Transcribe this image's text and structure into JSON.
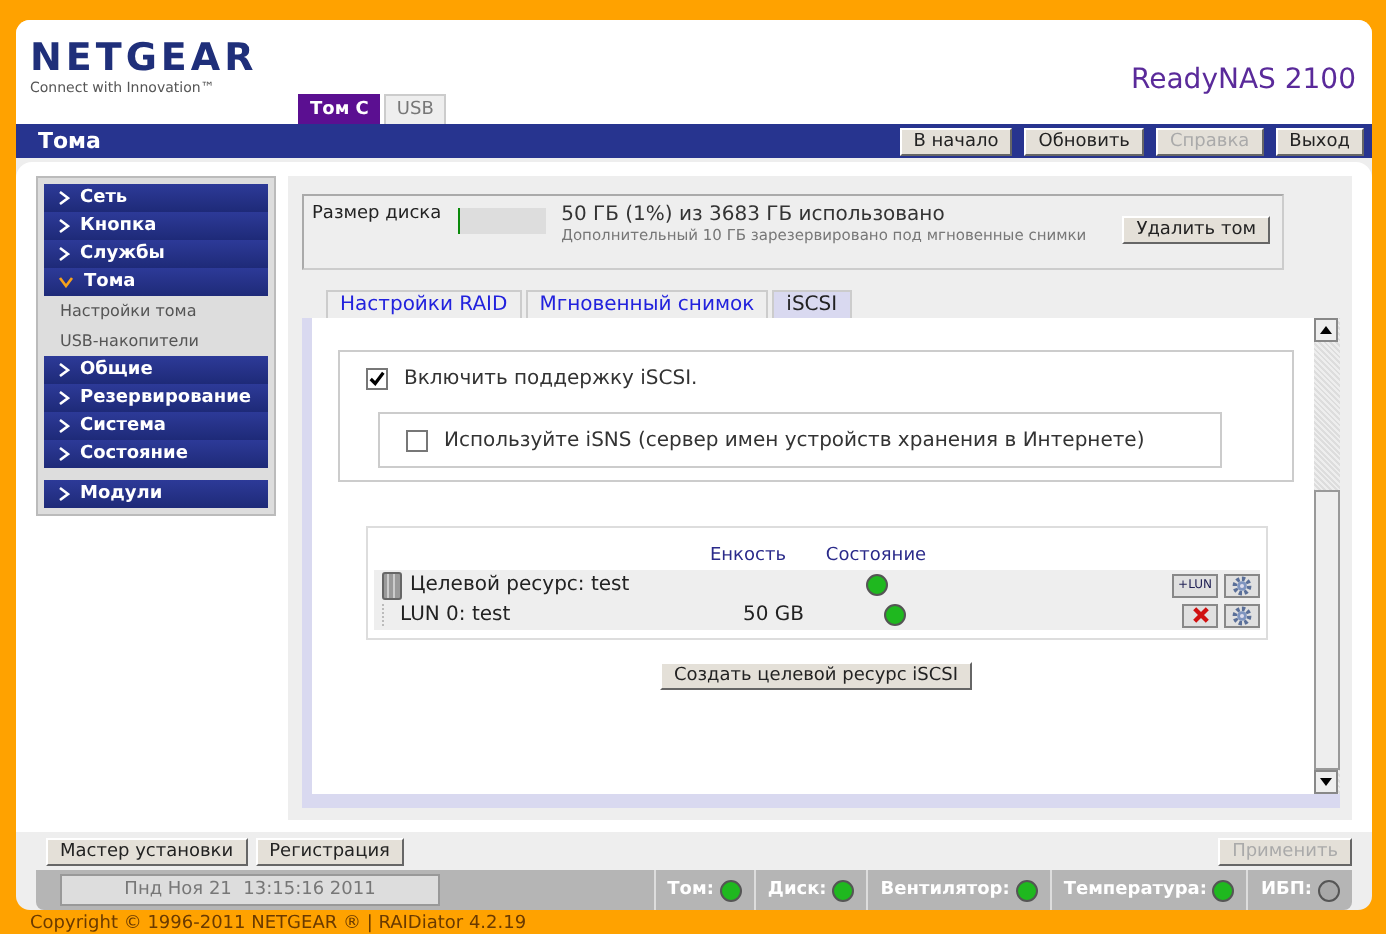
{
  "header": {
    "logo": "NETGEAR",
    "tagline": "Connect with Innovation™",
    "product": "ReadyNAS 2100",
    "tabs": [
      {
        "label": "Том C",
        "selected": true
      },
      {
        "label": "USB",
        "selected": false
      }
    ]
  },
  "title_bar": {
    "title": "Тома",
    "buttons": [
      {
        "label": "В начало",
        "disabled": false
      },
      {
        "label": "Обновить",
        "disabled": false
      },
      {
        "label": "Справка",
        "disabled": true
      },
      {
        "label": "Выход",
        "disabled": false
      }
    ]
  },
  "sidebar": {
    "groups": [
      {
        "items": [
          {
            "label": "Сеть",
            "expanded": false
          },
          {
            "label": "Кнопка",
            "expanded": false
          },
          {
            "label": "Службы",
            "expanded": false
          },
          {
            "label": "Тома",
            "expanded": true,
            "children": [
              {
                "label": "Настройки тома"
              },
              {
                "label": "USB-накопители"
              }
            ]
          },
          {
            "label": "Общие",
            "expanded": false
          },
          {
            "label": "Резервирование",
            "expanded": false
          },
          {
            "label": "Система",
            "expanded": false
          },
          {
            "label": "Состояние",
            "expanded": false
          }
        ]
      },
      {
        "items": [
          {
            "label": "Модули",
            "expanded": false
          }
        ]
      }
    ]
  },
  "disk": {
    "label": "Размер диска",
    "level": 0.01,
    "usage": "50 ГБ (1%) из 3683 ГБ использовано",
    "note": "Дополнительный 10 ГБ зарезервировано под мгновенные снимки",
    "button": "Удалить том"
  },
  "subtabs": [
    {
      "label": "Настройки RAID",
      "selected": false
    },
    {
      "label": "Мгновенный снимок",
      "selected": false
    },
    {
      "label": "iSCSI",
      "selected": true
    }
  ],
  "iscsi": {
    "enable": {
      "label": "Включить поддержку iSCSI.",
      "checked": true
    },
    "isns": {
      "label": "Используйте iSNS (сервер имен устройств хранения в Интернете)",
      "checked": false
    },
    "columns": [
      "Енкость",
      "Состояние"
    ],
    "rows": [
      {
        "kind": "target",
        "name": "Целевой ресурс: test",
        "color": "#1fb81f",
        "action": "+LUN"
      },
      {
        "kind": "lun",
        "name": "LUN 0: test",
        "capacity": "50 GB",
        "color": "#1fb81f"
      }
    ],
    "create_button": "Создать целевой ресурс iSCSI"
  },
  "footer": {
    "buttons": [
      "Мастер установки",
      "Регистрация"
    ],
    "apply": {
      "label": "Применить",
      "disabled": true
    },
    "datetime": "Пнд Ноя 21  13:15:16 2011",
    "indicators": [
      {
        "label": "Том:",
        "color": "#1fb81f"
      },
      {
        "label": "Диск:",
        "color": "#1fb81f"
      },
      {
        "label": "Вентилятор:",
        "color": "#1fb81f"
      },
      {
        "label": "Температура:",
        "color": "#1fb81f"
      },
      {
        "label": "ИБП:",
        "color": "#a8a8a8"
      }
    ],
    "copyright": "Copyright © 1996-2011 NETGEAR ® | RAIDiator 4.2.19"
  }
}
